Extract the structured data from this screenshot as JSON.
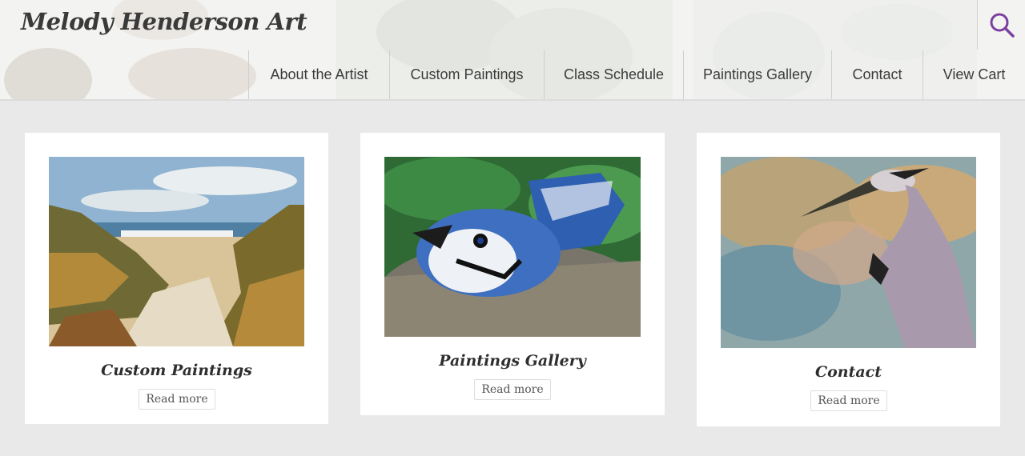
{
  "site": {
    "title": "Melody Henderson Art"
  },
  "header": {
    "search_icon": "search-icon",
    "accent": "#7b3fa0"
  },
  "nav": {
    "items": [
      {
        "label": "About the Artist"
      },
      {
        "label": "Custom Paintings"
      },
      {
        "label": "Class Schedule"
      },
      {
        "label": "Paintings Gallery"
      },
      {
        "label": "Contact"
      },
      {
        "label": "View Cart"
      }
    ]
  },
  "cards": [
    {
      "title": "Custom Paintings",
      "button": "Read more",
      "image": "beach-dunes-painting"
    },
    {
      "title": "Paintings Gallery",
      "button": "Read more",
      "image": "blue-jay-nest-painting"
    },
    {
      "title": "Contact",
      "button": "Read more",
      "image": "heron-painting"
    }
  ]
}
